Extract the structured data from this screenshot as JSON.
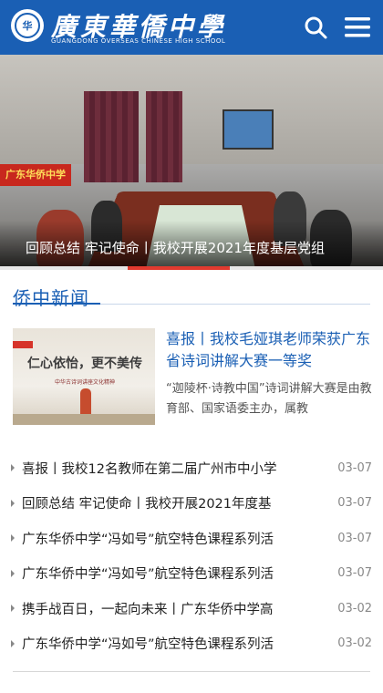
{
  "header": {
    "brand_cn": "廣東華僑中學",
    "brand_en": "GUANGDONG OVERSEAS CHINESE HIGH SCHOOL",
    "logo_text": "华",
    "search_icon": "search-icon",
    "menu_icon": "menu-icon",
    "colors": {
      "brand": "#1a5fb4",
      "accent": "#e23a2f"
    }
  },
  "banner": {
    "caption": "回顾总结 牢记使命丨我校开展2021年度基层党组",
    "sign_text": "广东华侨中学"
  },
  "news": {
    "section_title": "侨中新闻",
    "featured": {
      "title": "喜报丨我校毛娅琪老师荣获广东省诗词讲解大赛一等奖",
      "summary": "“迦陵杯·诗教中国”诗词讲解大赛是由教育部、国家语委主办，属教",
      "thumb_text": "仁心依怡，更不美传",
      "thumb_sub": "中华古诗词讲座文化精神"
    },
    "items": [
      {
        "title": "喜报丨我校12名教师在第二届广州市中小学",
        "date": "03-07"
      },
      {
        "title": "回顾总结 牢记使命丨我校开展2021年度基",
        "date": "03-07"
      },
      {
        "title": "广东华侨中学“冯如号”航空特色课程系列活",
        "date": "03-07"
      },
      {
        "title": "广东华侨中学“冯如号”航空特色课程系列活",
        "date": "03-07"
      },
      {
        "title": "携手战百日，一起向未来丨广东华侨中学高",
        "date": "03-02"
      },
      {
        "title": "广东华侨中学“冯如号”航空特色课程系列活",
        "date": "03-02"
      }
    ]
  }
}
